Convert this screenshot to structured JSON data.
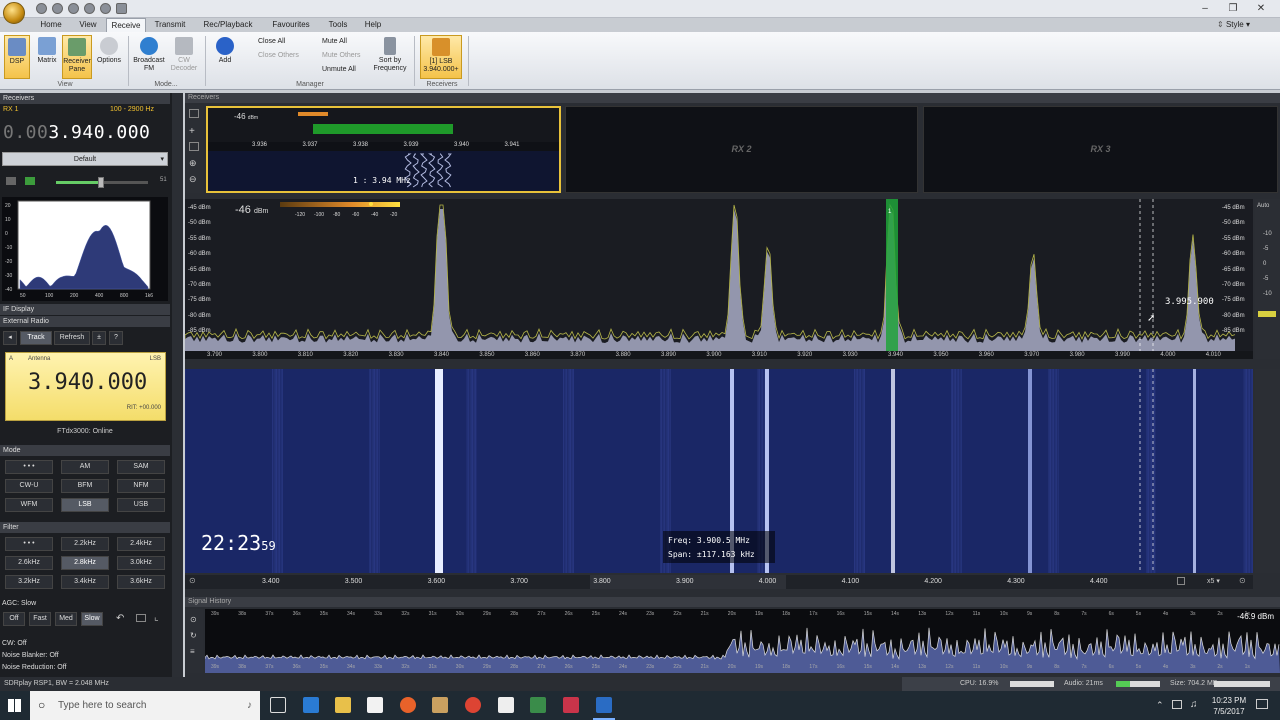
{
  "app": {
    "window_controls": {
      "minimize": "–",
      "restore": "❐",
      "close": "✕"
    },
    "style_label": "Style"
  },
  "menu_tabs": [
    "Home",
    "View",
    "Receive",
    "Transmit",
    "Rec/Playback",
    "Favourites",
    "Tools",
    "Help"
  ],
  "active_tab": "Receive",
  "ribbon": {
    "view_group": {
      "label": "View",
      "buttons": [
        {
          "label": "DSP"
        },
        {
          "label": "Matrix"
        },
        {
          "label": "Receiver Pane"
        },
        {
          "label": "Options"
        }
      ]
    },
    "mode_group": {
      "label": "Mode...",
      "buttons": [
        {
          "label": "Broadcast FM"
        },
        {
          "label": "CW Decoder"
        }
      ]
    },
    "manager_group": {
      "label": "Manager",
      "add": "Add",
      "close_all": "Close All",
      "close_others": "Close Others",
      "mute_all": "Mute All",
      "mute_others": "Mute Others",
      "unmute_all": "Unmute All",
      "sort_by_frequency": "Sort by Frequency"
    },
    "receivers_group": {
      "label": "Receivers",
      "rx_button_line1": "[1] LSB",
      "rx_button_line2": "3.940.000+"
    }
  },
  "left": {
    "receivers_header": "Receivers",
    "rx_label": "RX 1",
    "bandwidth": "100 - 2900 Hz",
    "freq_dim": "0.00",
    "freq_main": "3.940.000",
    "preset": "Default",
    "volume_value": "51",
    "spectrum_y_ticks": [
      "20",
      "10",
      "0",
      "-10",
      "-20",
      "-30",
      "-40"
    ],
    "spectrum_x_ticks": [
      "50",
      "100",
      "200",
      "400",
      "800",
      "1k6"
    ],
    "if_display": "IF Display",
    "external_radio": "External Radio",
    "ext_buttons": [
      "Track",
      "Refresh",
      "±",
      "?"
    ],
    "lcd": {
      "top_left": "A",
      "antenna": "Antenna",
      "mode": "LSB",
      "freq": "3.940.000",
      "rit": "RIT: +00.000"
    },
    "radio_status": "FTdx3000: Online",
    "mode_header": "Mode",
    "modes": [
      "• • •",
      "AM",
      "SAM",
      "CW-U",
      "BFM",
      "NFM",
      "WFM",
      "LSB",
      "USB"
    ],
    "selected_mode": "LSB",
    "filter_header": "Filter",
    "filters": [
      "• • •",
      "2.2kHz",
      "2.4kHz",
      "2.6kHz",
      "2.8kHz",
      "3.0kHz",
      "3.2kHz",
      "3.4kHz",
      "3.6kHz"
    ],
    "selected_filter": "2.8kHz",
    "agc_label": "AGC: Slow",
    "agc_buttons": [
      "Off",
      "Fast",
      "Med",
      "Slow"
    ],
    "selected_agc": "Slow",
    "cw": "CW: Off",
    "noise_blanker": "Noise Blanker: Off",
    "noise_reduction": "Noise Reduction: Off"
  },
  "rx1_mini": {
    "dbm": "-46",
    "dbm_unit": "dBm",
    "ticks": [
      "3.936",
      "3.937",
      "3.938",
      "3.939",
      "3.940",
      "3.941"
    ],
    "overlay": "1 : 3.94 MHz"
  },
  "rx2": "RX 2",
  "rx3": "RX 3",
  "spectrum": {
    "level": "-46",
    "level_unit": "dBm",
    "scale_ticks": [
      "-120",
      "-100",
      "-80",
      "-60",
      "-40",
      "-20"
    ],
    "db_ticks": [
      "-45 dBm",
      "-50 dBm",
      "-55 dBm",
      "-60 dBm",
      "-65 dBm",
      "-70 dBm",
      "-75 dBm",
      "-80 dBm",
      "-85 dBm"
    ],
    "freq_ticks": [
      "3.790",
      "3.800",
      "3.810",
      "3.820",
      "3.830",
      "3.840",
      "3.850",
      "3.860",
      "3.870",
      "3.880",
      "3.890",
      "3.900",
      "3.910",
      "3.920",
      "3.930",
      "3.940",
      "3.950",
      "3.960",
      "3.970",
      "3.980",
      "3.990",
      "4.000",
      "4.010"
    ],
    "cursor_readout": "3.995.900",
    "marker": "1",
    "auto": "Auto",
    "right_scale": [
      "-10",
      "-5",
      "0",
      "-5",
      "-10"
    ]
  },
  "waterfall": {
    "clock_hm": "22:23",
    "clock_s": "59",
    "freq_label": "Freq:",
    "freq_value": "3.900.5 MHz",
    "span_label": "Span:",
    "span_value": "±117.163 kHz"
  },
  "overview_ticks": [
    "3.400",
    "3.500",
    "3.600",
    "3.700",
    "3.800",
    "3.900",
    "4.000",
    "4.100",
    "4.200",
    "4.300",
    "4.400"
  ],
  "zoom": "x5",
  "signal_history": {
    "header": "Signal History",
    "level": "-46.9 dBm",
    "time_ticks": [
      "39s",
      "38s",
      "37s",
      "36s",
      "35s",
      "34s",
      "33s",
      "32s",
      "31s",
      "30s",
      "29s",
      "28s",
      "27s",
      "26s",
      "25s",
      "24s",
      "23s",
      "22s",
      "21s",
      "20s",
      "19s",
      "18s",
      "17s",
      "16s",
      "15s",
      "14s",
      "13s",
      "12s",
      "11s",
      "10s",
      "9s",
      "8s",
      "7s",
      "6s",
      "5s",
      "4s",
      "3s",
      "2s",
      "1s"
    ]
  },
  "status": {
    "device": "SDRplay RSP1, BW = 2.048 MHz",
    "cpu": "CPU: 16.9%",
    "audio": "Audio: 21ms",
    "size": "Size: 704.2 MB"
  },
  "taskbar": {
    "search_placeholder": "Type here to search",
    "time": "10:23 PM",
    "date": "7/5/2017"
  }
}
